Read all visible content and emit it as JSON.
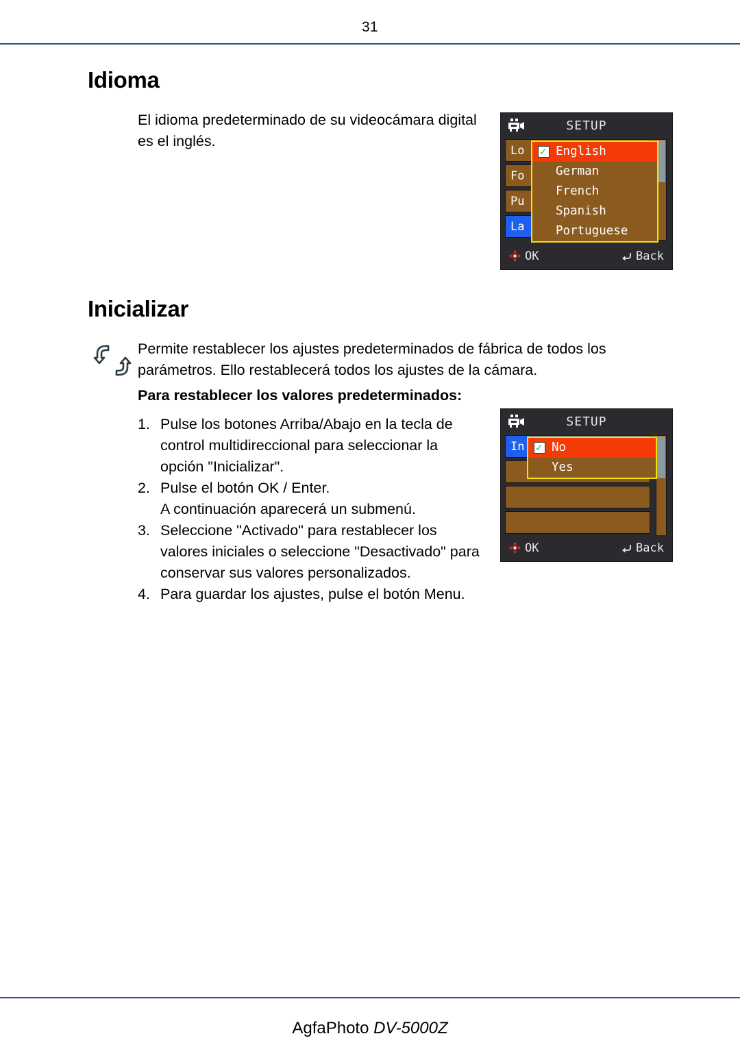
{
  "page": {
    "number": "31",
    "footer_brand": "AgfaPhoto",
    "footer_model": "DV-5000Z"
  },
  "sections": {
    "idioma": {
      "heading": "Idioma",
      "paragraph": "El idioma predeterminado de su videocámara digital es el inglés."
    },
    "inicializar": {
      "heading": "Inicializar",
      "paragraph": "Permite restablecer los ajustes predeterminados de fábrica de todos los parámetros. Ello restablecerá todos los ajustes de la cámara.",
      "bold_lead": "Para restablecer los valores predeterminados:",
      "steps": [
        {
          "num": "1.",
          "text": "Pulse los botones Arriba/Abajo en la tecla de control multidireccional para seleccionar la opción \"Inicializar\"."
        },
        {
          "num": "2.",
          "text": "Pulse el botón OK / Enter."
        },
        {
          "num": "",
          "text": "A continuación aparecerá un submenú."
        },
        {
          "num": "3.",
          "text": "Seleccione \"Activado\" para restablecer los valores iniciales o seleccione \"Desactivado\" para conservar sus valores personalizados."
        },
        {
          "num": "4.",
          "text": "Para guardar los ajustes, pulse el botón Menu."
        }
      ]
    }
  },
  "lcd_language": {
    "title": "SETUP",
    "camera_icon": "camcorder-icon",
    "menu_rows": [
      {
        "label": "Lo",
        "value": "",
        "selected": false
      },
      {
        "label": "Fo",
        "value": "]",
        "selected": false
      },
      {
        "label": "Pu",
        "value": "]",
        "selected": false
      },
      {
        "label": "La",
        "value": "}",
        "selected": true
      }
    ],
    "dropdown": {
      "items": [
        {
          "label": "English",
          "checked": true,
          "highlighted": true
        },
        {
          "label": "German",
          "checked": false,
          "highlighted": false
        },
        {
          "label": "French",
          "checked": false,
          "highlighted": false
        },
        {
          "label": "Spanish",
          "checked": false,
          "highlighted": false
        },
        {
          "label": "Portuguese",
          "checked": false,
          "highlighted": false
        }
      ]
    },
    "footer": {
      "ok_label": "OK",
      "back_label": "Back"
    }
  },
  "lcd_initialize": {
    "title": "SETUP",
    "camera_icon": "camcorder-icon",
    "menu_rows": [
      {
        "label": "In",
        "value": "",
        "selected": true
      },
      {
        "label": "",
        "value": "",
        "selected": false
      },
      {
        "label": "",
        "value": "",
        "selected": false
      },
      {
        "label": "",
        "value": "",
        "selected": false
      }
    ],
    "dropdown": {
      "items": [
        {
          "label": "No",
          "checked": true,
          "highlighted": true
        },
        {
          "label": "Yes",
          "checked": false,
          "highlighted": false
        }
      ]
    },
    "footer": {
      "ok_label": "OK",
      "back_label": "Back"
    }
  },
  "colors": {
    "rule_blue": "#2d4f8e",
    "lcd_bg": "#2b2b2f",
    "menu_brown": "#8b5a1e",
    "selected_blue": "#1f5fef",
    "highlight_orange": "#f43b07",
    "dropdown_border": "#f2e30c"
  }
}
